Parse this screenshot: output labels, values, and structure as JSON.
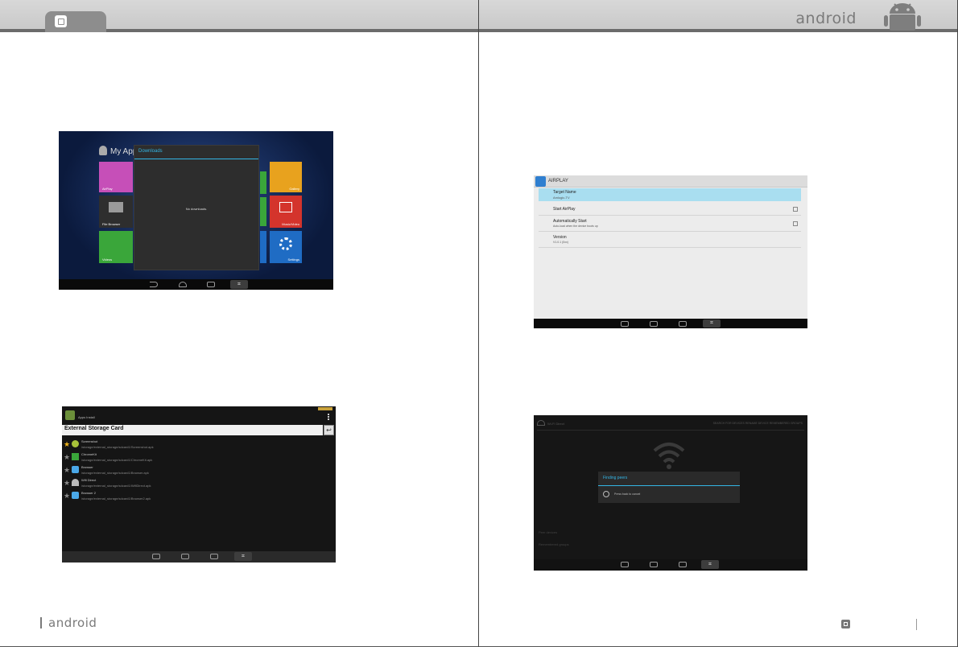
{
  "header": {
    "right_brand": "android"
  },
  "footer": {
    "left_brand": "android"
  },
  "screens": {
    "downloads": {
      "bg_label": "My App",
      "dialog_title": "Downloads",
      "dialog_message": "No downloads.",
      "tiles_left": [
        "AirPlay",
        "File Browser",
        "Videos"
      ],
      "tiles_right": [
        "Gallery",
        "Music/Video",
        "Settings"
      ]
    },
    "airplay": {
      "title": "AIRPLAY",
      "items": [
        {
          "label": "Target Name",
          "sub": "Amlogic-TV"
        },
        {
          "label": "Start AirPlay",
          "sub": ""
        },
        {
          "label": "Automatically Start",
          "sub": "Auto-load when the device boots up"
        },
        {
          "label": "Version",
          "sub": "V1.0.1 (0xx)"
        }
      ]
    },
    "files": {
      "app_name": "Apps Install",
      "path_title": "External Storage Card",
      "rows": [
        {
          "name": "Screenshot",
          "path": "/storage/external_storage/sdcard1/Screenshot.apk"
        },
        {
          "name": "ChromeKit",
          "path": "/storage/external_storage/sdcard1/ChromeKit.apk"
        },
        {
          "name": "Browser",
          "path": "/storage/external_storage/sdcard1/Browser.apk"
        },
        {
          "name": "Wifi Direct",
          "path": "/storage/external_storage/sdcard1/WifiDirect.apk"
        },
        {
          "name": "Browser 2",
          "path": "/storage/external_storage/sdcard1/Browser2.apk"
        }
      ]
    },
    "wifi_direct": {
      "top_left": "Wi-Fi Direct",
      "top_right": "SEARCH FOR DEVICES   RENAME DEVICE   REMEMBERED GROUPS",
      "dialog_title": "Finding peers",
      "dialog_message": "Press back to cancel",
      "bottom_1": "Peer devices",
      "bottom_2": "Remembered groups"
    }
  },
  "colors": {
    "accent_blue": "#33b5e5",
    "header_gray": "#d0d0d0"
  }
}
